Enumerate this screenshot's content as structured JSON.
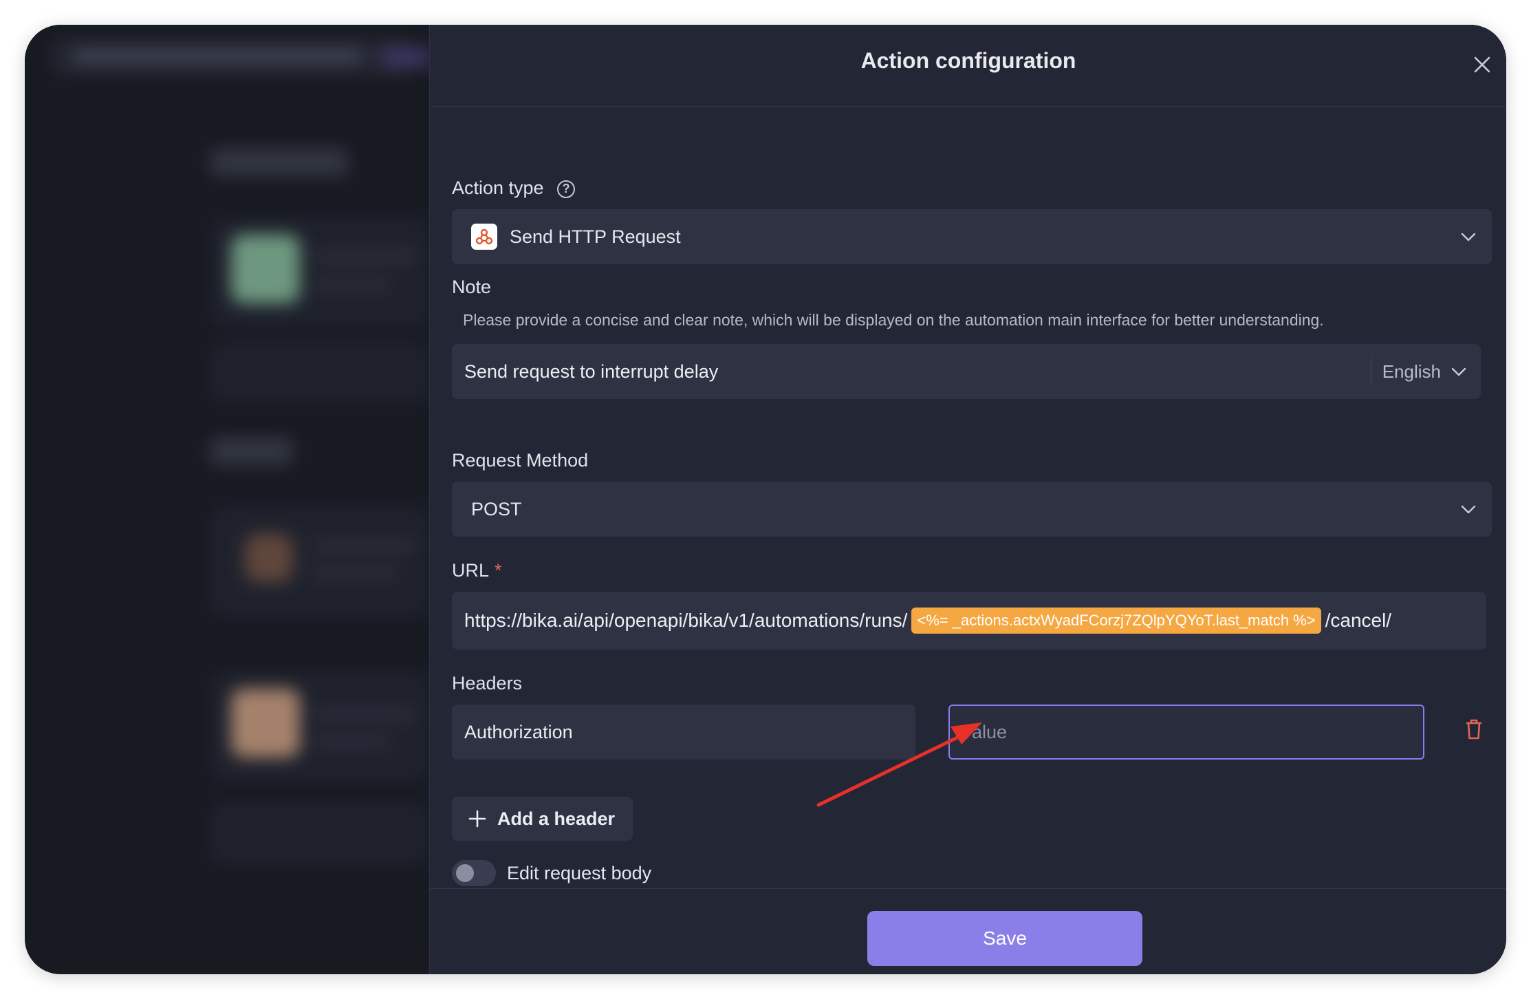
{
  "drawer": {
    "title": "Action configuration"
  },
  "action_type": {
    "label": "Action type",
    "help_icon_glyph": "?",
    "value": "Send HTTP Request"
  },
  "note": {
    "label": "Note",
    "description": "Please provide a concise and clear note, which will be displayed on the automation main interface for better understanding.",
    "value": "Send request to interrupt delay",
    "language": "English"
  },
  "request_method": {
    "label": "Request Method",
    "value": "POST"
  },
  "url": {
    "label": "URL",
    "required_mark": "*",
    "prefix": "https://bika.ai/api/openapi/bika/v1/automations/runs/",
    "variable": "<%= _actions.actxWyadFCorzj7ZQlpYQYoT.last_match %>",
    "suffix": "/cancel/"
  },
  "headers": {
    "label": "Headers",
    "key": "Authorization",
    "value_placeholder": "Value",
    "add_label": "Add a header"
  },
  "request_body": {
    "toggle_label": "Edit request body",
    "enabled": false
  },
  "footer": {
    "save_label": "Save"
  },
  "colors": {
    "accent": "#8a7ee8",
    "variable_chip": "#f5a742",
    "danger": "#e2655a",
    "annotation_arrow": "#e8302a"
  }
}
